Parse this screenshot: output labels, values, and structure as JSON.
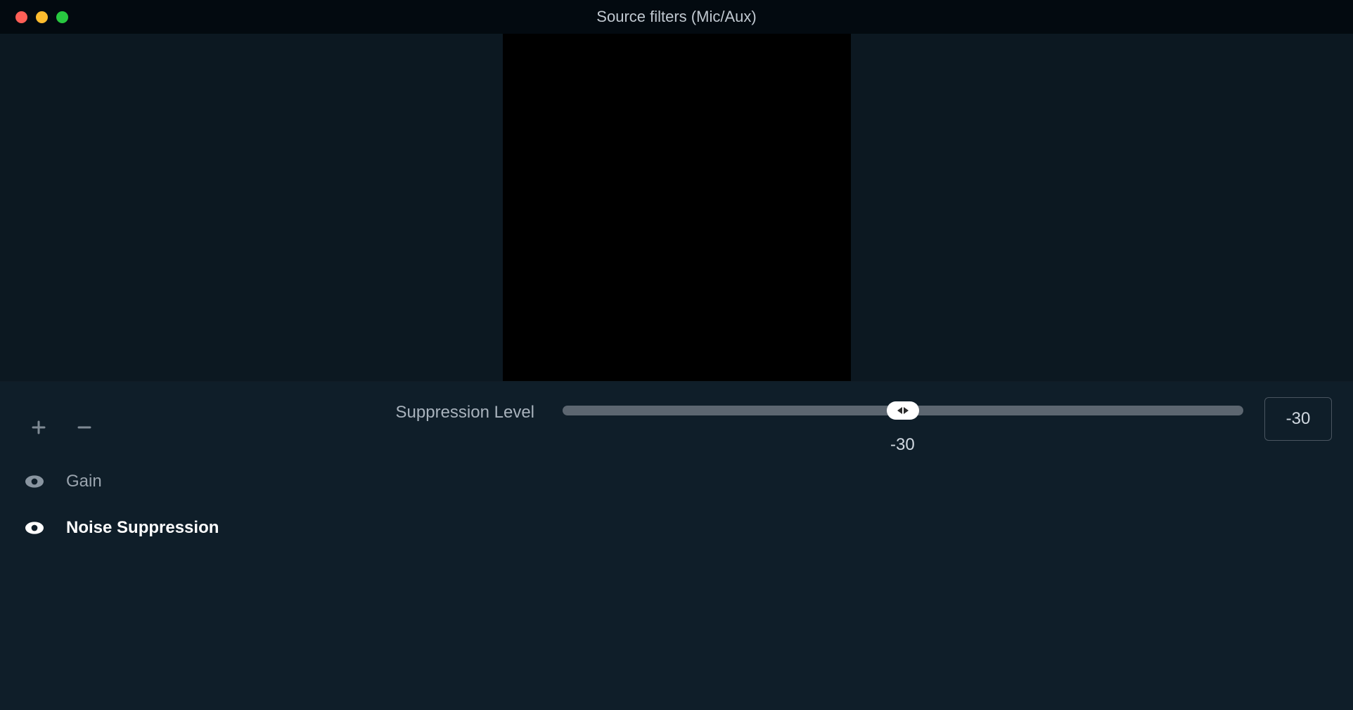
{
  "window": {
    "title": "Source filters (Mic/Aux)"
  },
  "filters": {
    "items": [
      {
        "label": "Gain",
        "selected": false
      },
      {
        "label": "Noise Suppression",
        "selected": true
      }
    ]
  },
  "settings": {
    "suppression": {
      "label": "Suppression Level",
      "value": "-30",
      "display_below": "-30",
      "min": -60,
      "max": 0,
      "slider_percent": 50
    }
  }
}
